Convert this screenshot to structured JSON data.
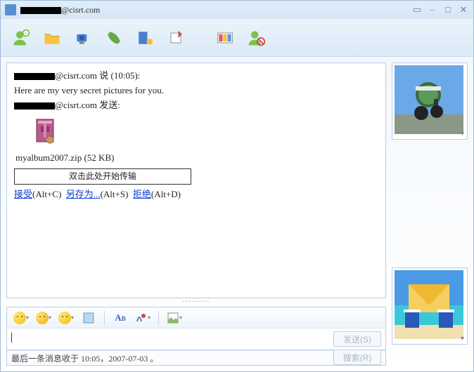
{
  "title": {
    "domain": "@cisrt.com"
  },
  "toolbar_icons": [
    "invite",
    "files",
    "webcam",
    "call",
    "activities",
    "games",
    "gallery",
    "block"
  ],
  "conversation": {
    "sender_domain": "@cisrt.com",
    "says": " 说 (10:05):",
    "message": "  Here are my very secret pictures for you.",
    "sends": " 发送:",
    "file": {
      "name": "myalbum2007.zip",
      "size": "(52 KB)"
    },
    "transfer_hint": "双击此处开始传输",
    "accept": {
      "label": "接受",
      "key": "(Alt+C)"
    },
    "saveas": {
      "label": "另存为...",
      "key": "(Alt+S)"
    },
    "decline": {
      "label": "拒绝",
      "key": "(Alt+D)"
    }
  },
  "compose": {
    "send_btn": "发送(S)",
    "search_btn": "搜索(R)"
  },
  "status": {
    "text": "最后一条消息收于 10:05，2007-07-03 。"
  }
}
